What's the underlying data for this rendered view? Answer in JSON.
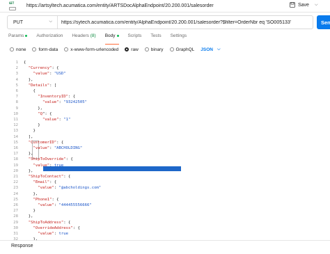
{
  "titlebar": {
    "icon_text": "GET",
    "title": "https://artsyltech.acumatica.com/entity/ARTSDocAlphaEndpoint/20.200.001/salesorder",
    "save_label": "Save"
  },
  "request": {
    "method": "PUT",
    "url": "https://sytech.acumatica.com/entity/AlphaEndpoint/20.200.001/salesorder?$filter=OrderNbr eq 'SO005133'",
    "send_label": "Sen"
  },
  "tabs": [
    {
      "label": "Params",
      "dot": true
    },
    {
      "label": "Authorization"
    },
    {
      "label": "Headers",
      "count": "(8)"
    },
    {
      "label": "Body",
      "dot": true,
      "active": true
    },
    {
      "label": "Scripts"
    },
    {
      "label": "Tests"
    },
    {
      "label": "Settings"
    }
  ],
  "body_types": [
    {
      "label": "none",
      "selected": false
    },
    {
      "label": "form-data",
      "selected": false
    },
    {
      "label": "x-www-form-urlencoded",
      "selected": false
    },
    {
      "label": "raw",
      "selected": true
    },
    {
      "label": "binary",
      "selected": false
    },
    {
      "label": "GraphQL",
      "selected": false
    }
  ],
  "language": "JSON",
  "editor": {
    "lines": [
      {
        "n": "1",
        "t": [
          [
            "p",
            "{"
          ]
        ]
      },
      {
        "n": "2",
        "t": [
          [
            "p",
            "  "
          ],
          [
            "key",
            "\"Currency\""
          ],
          [
            "p",
            ": {"
          ]
        ]
      },
      {
        "n": "3",
        "t": [
          [
            "p",
            "    "
          ],
          [
            "key",
            "\"value\""
          ],
          [
            "p",
            ": "
          ],
          [
            "str",
            "\"USD\""
          ]
        ]
      },
      {
        "n": "4",
        "t": [
          [
            "p",
            "  },"
          ]
        ]
      },
      {
        "n": "5",
        "t": [
          [
            "p",
            "  "
          ],
          [
            "key",
            "\"Details\""
          ],
          [
            "p",
            ": ["
          ]
        ]
      },
      {
        "n": "6",
        "t": [
          [
            "p",
            "    {"
          ]
        ]
      },
      {
        "n": "7",
        "t": [
          [
            "p",
            "      "
          ],
          [
            "key",
            "\"InventoryID\""
          ],
          [
            "p",
            ": {"
          ]
        ]
      },
      {
        "n": "8",
        "t": [
          [
            "p",
            "        "
          ],
          [
            "key",
            "\"value\""
          ],
          [
            "p",
            ": "
          ],
          [
            "str",
            "\"93242505\""
          ]
        ]
      },
      {
        "n": "9",
        "t": [
          [
            "p",
            "      },"
          ]
        ]
      },
      {
        "n": "10",
        "t": [
          [
            "p",
            "      "
          ],
          [
            "key",
            "\"Q"
          ],
          [
            "p",
            "\": {"
          ]
        ]
      },
      {
        "n": "11",
        "t": [
          [
            "p",
            "        "
          ],
          [
            "key",
            "\"value\""
          ],
          [
            "p",
            ": "
          ],
          [
            "str",
            "\"1\""
          ]
        ]
      },
      {
        "n": "12",
        "t": [
          [
            "p",
            "      }"
          ]
        ]
      },
      {
        "n": "13",
        "t": [
          [
            "p",
            "    }"
          ]
        ]
      },
      {
        "n": "14",
        "t": [
          [
            "p",
            "  ],"
          ]
        ]
      },
      {
        "n": "15",
        "t": [
          [
            "p",
            "  "
          ],
          [
            "key",
            "\"CustomerID\""
          ],
          [
            "p",
            ": {"
          ]
        ]
      },
      {
        "n": "16",
        "t": [
          [
            "p",
            "    "
          ],
          [
            "key",
            "\"value\""
          ],
          [
            "p",
            ": "
          ],
          [
            "str",
            "\"ABCHOLDING\""
          ]
        ]
      },
      {
        "n": "17",
        "t": [
          [
            "p",
            "  },"
          ]
        ]
      },
      {
        "n": "18",
        "t": [
          [
            "p",
            "  "
          ],
          [
            "key",
            "\"ShipToOverride\""
          ],
          [
            "p",
            ": {"
          ]
        ]
      },
      {
        "n": "19",
        "t": [
          [
            "p",
            "    "
          ],
          [
            "key",
            "\"value\""
          ],
          [
            "p",
            ": "
          ],
          [
            "kw",
            "true"
          ]
        ]
      },
      {
        "n": "20",
        "t": [
          [
            "p",
            "  },"
          ]
        ]
      },
      {
        "n": "21",
        "t": [
          [
            "p",
            "  "
          ],
          [
            "key",
            "\"ShipToContact\""
          ],
          [
            "p",
            ": {"
          ]
        ]
      },
      {
        "n": "22",
        "t": [
          [
            "p",
            "    "
          ],
          [
            "key",
            "\"Email\""
          ],
          [
            "p",
            ": {"
          ]
        ]
      },
      {
        "n": "23",
        "t": [
          [
            "p",
            "      "
          ],
          [
            "key",
            "\"value\""
          ],
          [
            "p",
            ": "
          ],
          [
            "str",
            "\"@abcholdings.com\""
          ]
        ]
      },
      {
        "n": "24",
        "t": [
          [
            "p",
            "    },"
          ]
        ]
      },
      {
        "n": "25",
        "t": [
          [
            "p",
            "    "
          ],
          [
            "key",
            "\"Phone1\""
          ],
          [
            "p",
            ": {"
          ]
        ]
      },
      {
        "n": "26",
        "t": [
          [
            "p",
            "      "
          ],
          [
            "key",
            "\"value\""
          ],
          [
            "p",
            ": "
          ],
          [
            "str",
            "\"444455556666\""
          ]
        ]
      },
      {
        "n": "27",
        "t": [
          [
            "p",
            "    }"
          ]
        ]
      },
      {
        "n": "28",
        "t": [
          [
            "p",
            "  },"
          ]
        ]
      },
      {
        "n": "29",
        "t": [
          [
            "p",
            "  "
          ],
          [
            "key",
            "\"ShipToAddress\""
          ],
          [
            "p",
            ": {"
          ]
        ]
      },
      {
        "n": "30",
        "t": [
          [
            "p",
            "    "
          ],
          [
            "key",
            "\"OverrideAddress\""
          ],
          [
            "p",
            ": {"
          ]
        ]
      },
      {
        "n": "31",
        "t": [
          [
            "p",
            "      "
          ],
          [
            "key",
            "\"value\""
          ],
          [
            "p",
            ": "
          ],
          [
            "kw",
            "true"
          ]
        ]
      },
      {
        "n": "32",
        "t": [
          [
            "p",
            "    },"
          ]
        ]
      }
    ]
  },
  "response_label": "Response",
  "colors": {
    "accent_tab": "#ff6c37",
    "send_button": "#097bed",
    "json_key": "#c41a16",
    "json_string": "#1a55c8",
    "selection": "#1e67c9"
  }
}
